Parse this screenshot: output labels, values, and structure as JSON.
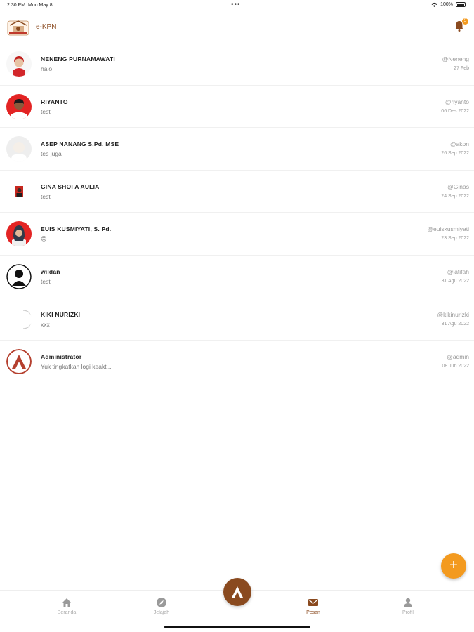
{
  "status_bar": {
    "time": "2:30 PM",
    "date": "Mon May 8",
    "dots": "•••",
    "battery": "100%"
  },
  "header": {
    "title": "e-KPN",
    "notification_count": "5"
  },
  "chats": [
    {
      "name": "NENENG PURNAMAWATI",
      "message": "halo",
      "username": "@Neneng",
      "date": "27 Feb",
      "avatar": "photo-woman-red"
    },
    {
      "name": "RIYANTO",
      "message": "test",
      "username": "@riyanto",
      "date": "06 Des 2022",
      "avatar": "photo-man-red"
    },
    {
      "name": "ASEP NANANG S,Pd. MSE",
      "message": "tes juga",
      "username": "@akon",
      "date": "26 Sep 2022",
      "avatar": "photo-man-light"
    },
    {
      "name": "GINA SHOFA AULIA",
      "message": "test",
      "username": "@Ginas",
      "date": "24 Sep 2022",
      "avatar": "photo-small"
    },
    {
      "name": "EUIS KUSMIYATI, S. Pd.",
      "message": "😊",
      "username": "@euiskusmiyati",
      "date": "23 Sep 2022",
      "avatar": "photo-woman-red"
    },
    {
      "name": "wildan",
      "message": "test",
      "username": "@latifah",
      "date": "31 Agu 2022",
      "avatar": "default-person"
    },
    {
      "name": "KIKI NURIZKI",
      "message": "xxx",
      "username": "@kikinurizki",
      "date": "31 Agu 2022",
      "avatar": "blank"
    },
    {
      "name": "Administrator",
      "message": "Yuk tingkatkan logi keakt...",
      "username": "@admin",
      "date": "08 Jun 2022",
      "avatar": "admin-logo"
    }
  ],
  "fab": {
    "label": "+"
  },
  "nav": {
    "items": [
      {
        "label": "Beranda",
        "icon": "home-icon"
      },
      {
        "label": "Jelajah",
        "icon": "compass-icon"
      },
      {
        "label": "Pesan",
        "icon": "mail-icon"
      },
      {
        "label": "Profil",
        "icon": "person-icon"
      }
    ]
  },
  "colors": {
    "brand": "#8a4a1f",
    "accent": "#f39a1f"
  }
}
